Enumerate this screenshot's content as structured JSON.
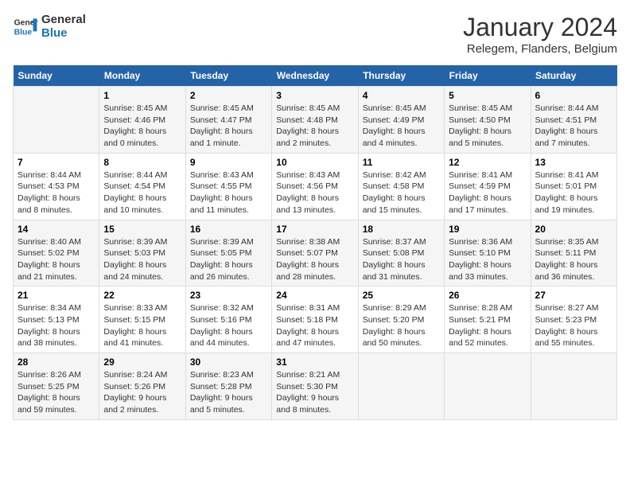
{
  "header": {
    "logo_line1": "General",
    "logo_line2": "Blue",
    "month_year": "January 2024",
    "location": "Relegem, Flanders, Belgium"
  },
  "days_of_week": [
    "Sunday",
    "Monday",
    "Tuesday",
    "Wednesday",
    "Thursday",
    "Friday",
    "Saturday"
  ],
  "weeks": [
    [
      {
        "day": "",
        "sunrise": "",
        "sunset": "",
        "daylight": ""
      },
      {
        "day": "1",
        "sunrise": "Sunrise: 8:45 AM",
        "sunset": "Sunset: 4:46 PM",
        "daylight": "Daylight: 8 hours and 0 minutes."
      },
      {
        "day": "2",
        "sunrise": "Sunrise: 8:45 AM",
        "sunset": "Sunset: 4:47 PM",
        "daylight": "Daylight: 8 hours and 1 minute."
      },
      {
        "day": "3",
        "sunrise": "Sunrise: 8:45 AM",
        "sunset": "Sunset: 4:48 PM",
        "daylight": "Daylight: 8 hours and 2 minutes."
      },
      {
        "day": "4",
        "sunrise": "Sunrise: 8:45 AM",
        "sunset": "Sunset: 4:49 PM",
        "daylight": "Daylight: 8 hours and 4 minutes."
      },
      {
        "day": "5",
        "sunrise": "Sunrise: 8:45 AM",
        "sunset": "Sunset: 4:50 PM",
        "daylight": "Daylight: 8 hours and 5 minutes."
      },
      {
        "day": "6",
        "sunrise": "Sunrise: 8:44 AM",
        "sunset": "Sunset: 4:51 PM",
        "daylight": "Daylight: 8 hours and 7 minutes."
      }
    ],
    [
      {
        "day": "7",
        "sunrise": "Sunrise: 8:44 AM",
        "sunset": "Sunset: 4:53 PM",
        "daylight": "Daylight: 8 hours and 8 minutes."
      },
      {
        "day": "8",
        "sunrise": "Sunrise: 8:44 AM",
        "sunset": "Sunset: 4:54 PM",
        "daylight": "Daylight: 8 hours and 10 minutes."
      },
      {
        "day": "9",
        "sunrise": "Sunrise: 8:43 AM",
        "sunset": "Sunset: 4:55 PM",
        "daylight": "Daylight: 8 hours and 11 minutes."
      },
      {
        "day": "10",
        "sunrise": "Sunrise: 8:43 AM",
        "sunset": "Sunset: 4:56 PM",
        "daylight": "Daylight: 8 hours and 13 minutes."
      },
      {
        "day": "11",
        "sunrise": "Sunrise: 8:42 AM",
        "sunset": "Sunset: 4:58 PM",
        "daylight": "Daylight: 8 hours and 15 minutes."
      },
      {
        "day": "12",
        "sunrise": "Sunrise: 8:41 AM",
        "sunset": "Sunset: 4:59 PM",
        "daylight": "Daylight: 8 hours and 17 minutes."
      },
      {
        "day": "13",
        "sunrise": "Sunrise: 8:41 AM",
        "sunset": "Sunset: 5:01 PM",
        "daylight": "Daylight: 8 hours and 19 minutes."
      }
    ],
    [
      {
        "day": "14",
        "sunrise": "Sunrise: 8:40 AM",
        "sunset": "Sunset: 5:02 PM",
        "daylight": "Daylight: 8 hours and 21 minutes."
      },
      {
        "day": "15",
        "sunrise": "Sunrise: 8:39 AM",
        "sunset": "Sunset: 5:03 PM",
        "daylight": "Daylight: 8 hours and 24 minutes."
      },
      {
        "day": "16",
        "sunrise": "Sunrise: 8:39 AM",
        "sunset": "Sunset: 5:05 PM",
        "daylight": "Daylight: 8 hours and 26 minutes."
      },
      {
        "day": "17",
        "sunrise": "Sunrise: 8:38 AM",
        "sunset": "Sunset: 5:07 PM",
        "daylight": "Daylight: 8 hours and 28 minutes."
      },
      {
        "day": "18",
        "sunrise": "Sunrise: 8:37 AM",
        "sunset": "Sunset: 5:08 PM",
        "daylight": "Daylight: 8 hours and 31 minutes."
      },
      {
        "day": "19",
        "sunrise": "Sunrise: 8:36 AM",
        "sunset": "Sunset: 5:10 PM",
        "daylight": "Daylight: 8 hours and 33 minutes."
      },
      {
        "day": "20",
        "sunrise": "Sunrise: 8:35 AM",
        "sunset": "Sunset: 5:11 PM",
        "daylight": "Daylight: 8 hours and 36 minutes."
      }
    ],
    [
      {
        "day": "21",
        "sunrise": "Sunrise: 8:34 AM",
        "sunset": "Sunset: 5:13 PM",
        "daylight": "Daylight: 8 hours and 38 minutes."
      },
      {
        "day": "22",
        "sunrise": "Sunrise: 8:33 AM",
        "sunset": "Sunset: 5:15 PM",
        "daylight": "Daylight: 8 hours and 41 minutes."
      },
      {
        "day": "23",
        "sunrise": "Sunrise: 8:32 AM",
        "sunset": "Sunset: 5:16 PM",
        "daylight": "Daylight: 8 hours and 44 minutes."
      },
      {
        "day": "24",
        "sunrise": "Sunrise: 8:31 AM",
        "sunset": "Sunset: 5:18 PM",
        "daylight": "Daylight: 8 hours and 47 minutes."
      },
      {
        "day": "25",
        "sunrise": "Sunrise: 8:29 AM",
        "sunset": "Sunset: 5:20 PM",
        "daylight": "Daylight: 8 hours and 50 minutes."
      },
      {
        "day": "26",
        "sunrise": "Sunrise: 8:28 AM",
        "sunset": "Sunset: 5:21 PM",
        "daylight": "Daylight: 8 hours and 52 minutes."
      },
      {
        "day": "27",
        "sunrise": "Sunrise: 8:27 AM",
        "sunset": "Sunset: 5:23 PM",
        "daylight": "Daylight: 8 hours and 55 minutes."
      }
    ],
    [
      {
        "day": "28",
        "sunrise": "Sunrise: 8:26 AM",
        "sunset": "Sunset: 5:25 PM",
        "daylight": "Daylight: 8 hours and 59 minutes."
      },
      {
        "day": "29",
        "sunrise": "Sunrise: 8:24 AM",
        "sunset": "Sunset: 5:26 PM",
        "daylight": "Daylight: 9 hours and 2 minutes."
      },
      {
        "day": "30",
        "sunrise": "Sunrise: 8:23 AM",
        "sunset": "Sunset: 5:28 PM",
        "daylight": "Daylight: 9 hours and 5 minutes."
      },
      {
        "day": "31",
        "sunrise": "Sunrise: 8:21 AM",
        "sunset": "Sunset: 5:30 PM",
        "daylight": "Daylight: 9 hours and 8 minutes."
      },
      {
        "day": "",
        "sunrise": "",
        "sunset": "",
        "daylight": ""
      },
      {
        "day": "",
        "sunrise": "",
        "sunset": "",
        "daylight": ""
      },
      {
        "day": "",
        "sunrise": "",
        "sunset": "",
        "daylight": ""
      }
    ]
  ]
}
